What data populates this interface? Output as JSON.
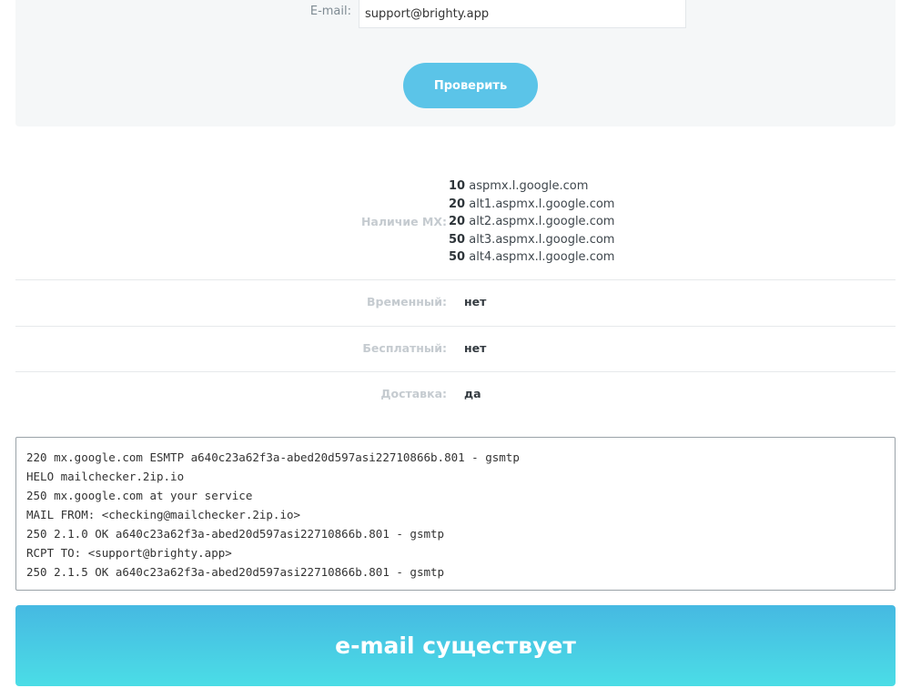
{
  "form": {
    "email_label": "E-mail:",
    "email_value": "support@brighty.app",
    "check_label": "Проверить"
  },
  "results": {
    "mx": {
      "label": "Наличие MX:",
      "records": [
        {
          "priority": "10",
          "host": "aspmx.l.google.com"
        },
        {
          "priority": "20",
          "host": "alt1.aspmx.l.google.com"
        },
        {
          "priority": "20",
          "host": "alt2.aspmx.l.google.com"
        },
        {
          "priority": "50",
          "host": "alt3.aspmx.l.google.com"
        },
        {
          "priority": "50",
          "host": "alt4.aspmx.l.google.com"
        }
      ]
    },
    "temporary": {
      "label": "Временный:",
      "value": "нет"
    },
    "free": {
      "label": "Бесплатный:",
      "value": "нет"
    },
    "delivery": {
      "label": "Доставка:",
      "value": "да"
    }
  },
  "smtp_log": [
    "220 mx.google.com ESMTP a640c23a62f3a-abed20d597asi22710866b.801 - gsmtp",
    "HELO mailchecker.2ip.io",
    "250 mx.google.com at your service",
    "MAIL FROM: <checking@mailchecker.2ip.io>",
    "250 2.1.0 OK a640c23a62f3a-abed20d597asi22710866b.801 - gsmtp",
    "RCPT TO: <support@brighty.app>",
    "250 2.1.5 OK a640c23a62f3a-abed20d597asi22710866b.801 - gsmtp"
  ],
  "verdict": "e-mail существует"
}
